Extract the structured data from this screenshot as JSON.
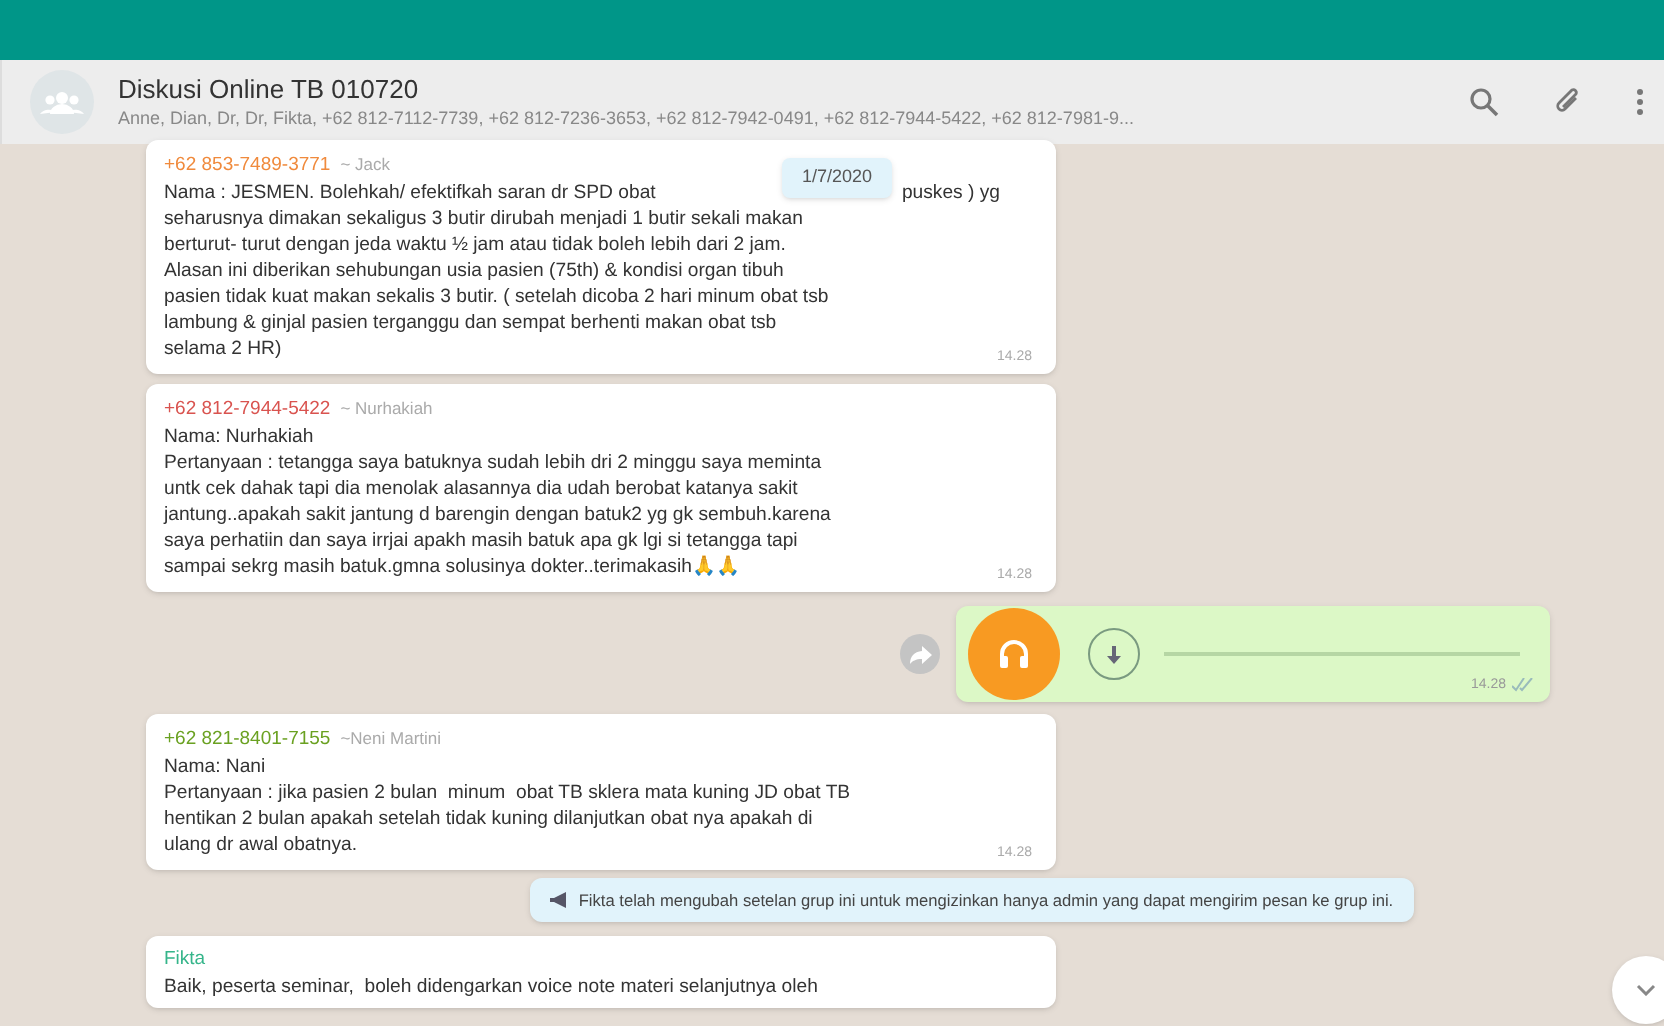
{
  "header": {
    "title": "Diskusi Online TB 010720",
    "participants": "Anne, Dian, Dr, Dr, Fikta, +62 812-7112-7739, +62 812-7236-3653, +62 812-7942-0491, +62 812-7944-5422, +62 812-7981-9..."
  },
  "date_badge": "1/7/2020",
  "messages": [
    {
      "kind": "text",
      "sender": "+62 853-7489-3771",
      "color": "#f08a3c",
      "push_name": "~ Jack",
      "lines": [
        "Nama : JESMEN. Bolehkah/ efektifkah saran dr SPD obat",
        "puskes ) yg",
        "seharusnya dimakan sekaligus 3 butir dirubah menjadi 1 butir sekali makan",
        "berturut- turut dengan jeda waktu ½ jam atau tidak boleh lebih dari 2 jam.",
        "Alasan ini diberikan sehubungan usia pasien (75th) & kondisi organ tibuh",
        "pasien tidak kuat makan sekalis 3 butir. ( setelah dicoba 2 hari minum obat tsb",
        "lambung & ginjal pasien terganggu dan sempat berhenti makan obat tsb",
        "selama 2 HR)"
      ],
      "time": "14.28"
    },
    {
      "kind": "text",
      "sender": "+62 812-7944-5422",
      "color": "#d9534f",
      "push_name": "~ Nurhakiah",
      "lines": [
        "Nama: Nurhakiah",
        "Pertanyaan : tetangga saya batuknya sudah lebih dri 2 minggu saya meminta",
        "untk cek dahak tapi dia menolak alasannya dia udah berobat katanya sakit",
        "jantung..apakah sakit jantung d barengin dengan batuk2 yg gk sembuh.karena",
        "saya perhatiin dan saya irrjai apakh masih batuk apa gk lgi si tetangga tapi",
        "sampai sekrg masih batuk.gmna solusinya dokter..terimakasih🙏🙏"
      ],
      "time": "14.28"
    },
    {
      "kind": "voice",
      "time": "14.28",
      "read": true
    },
    {
      "kind": "text",
      "sender": "+62 821-8401-7155",
      "color": "#6aa121",
      "push_name": "~Neni Martini",
      "lines": [
        "Nama: Nani",
        "Pertanyaan : jika pasien 2 bulan  minum  obat TB sklera mata kuning JD obat TB",
        "hentikan 2 bulan apakah setelah tidak kuning dilanjutkan obat nya apakah di",
        "ulang dr awal obatnya."
      ],
      "time": "14.28"
    },
    {
      "kind": "system",
      "text": "Fikta telah mengubah setelan grup ini untuk mengizinkan hanya admin yang dapat mengirim pesan ke grup ini."
    },
    {
      "kind": "text",
      "sender": "Fikta",
      "color": "#35b58a",
      "lines": [
        "Baik, peserta seminar,  boleh didengarkan voice note materi selanjutnya oleh"
      ]
    }
  ]
}
